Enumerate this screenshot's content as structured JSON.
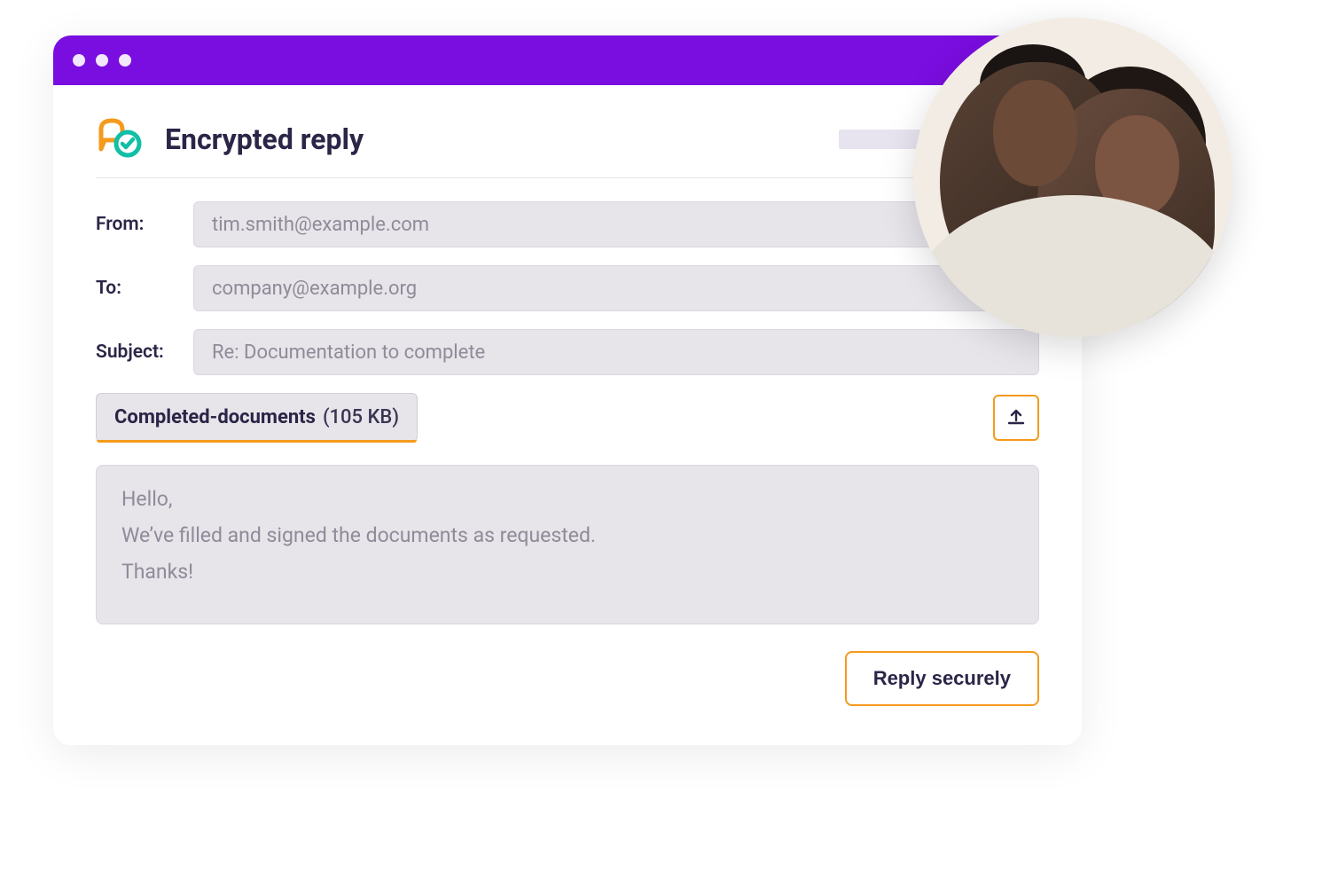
{
  "header": {
    "title": "Encrypted reply"
  },
  "labels": {
    "from": "From:",
    "to": "To:",
    "subject": "Subject:"
  },
  "fields": {
    "from": "tim.smith@example.com",
    "to": "company@example.org",
    "subject": "Re: Documentation to complete"
  },
  "attachment": {
    "name": "Completed-documents",
    "size": "(105 KB)"
  },
  "body": {
    "line1": "Hello,",
    "line2": "We’ve filled and signed the documents as requested.",
    "line3": "Thanks!"
  },
  "actions": {
    "reply": "Reply securely"
  },
  "colors": {
    "accent_purple": "#7A0DE0",
    "accent_orange": "#F59A1C",
    "accent_teal": "#11BFA6",
    "text_dark": "#2B2547"
  }
}
